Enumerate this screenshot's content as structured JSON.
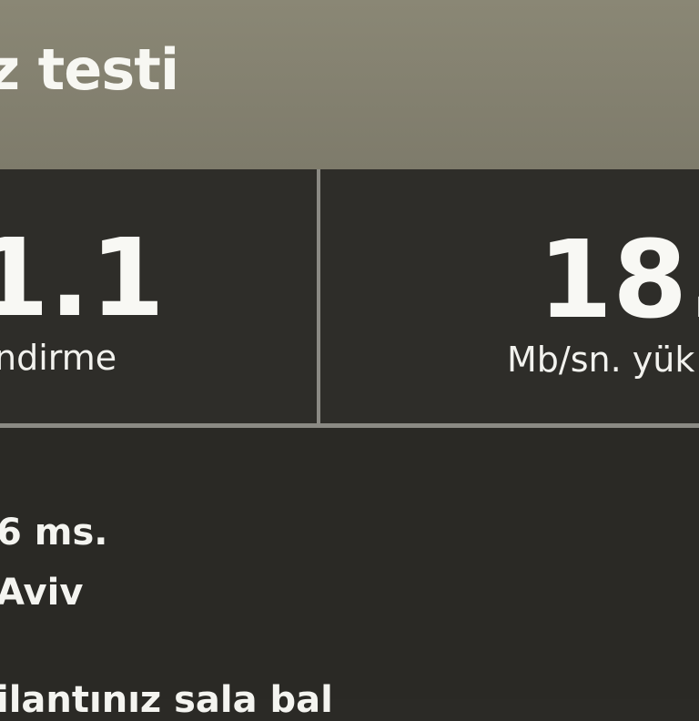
{
  "header": {
    "title": "z testi"
  },
  "metrics": {
    "download": {
      "value": "1.1",
      "label": "ndirme"
    },
    "upload": {
      "value": "18.",
      "label": "Mb/sn. yük"
    }
  },
  "details": {
    "ping": "6 ms.",
    "server": "Aviv",
    "extra": "ilantınız sala bal"
  },
  "colors": {
    "header_bg": "#8a8775",
    "panel_bg": "#2e2d29",
    "divider": "#8b8a84",
    "text": "#f4f4f0"
  }
}
